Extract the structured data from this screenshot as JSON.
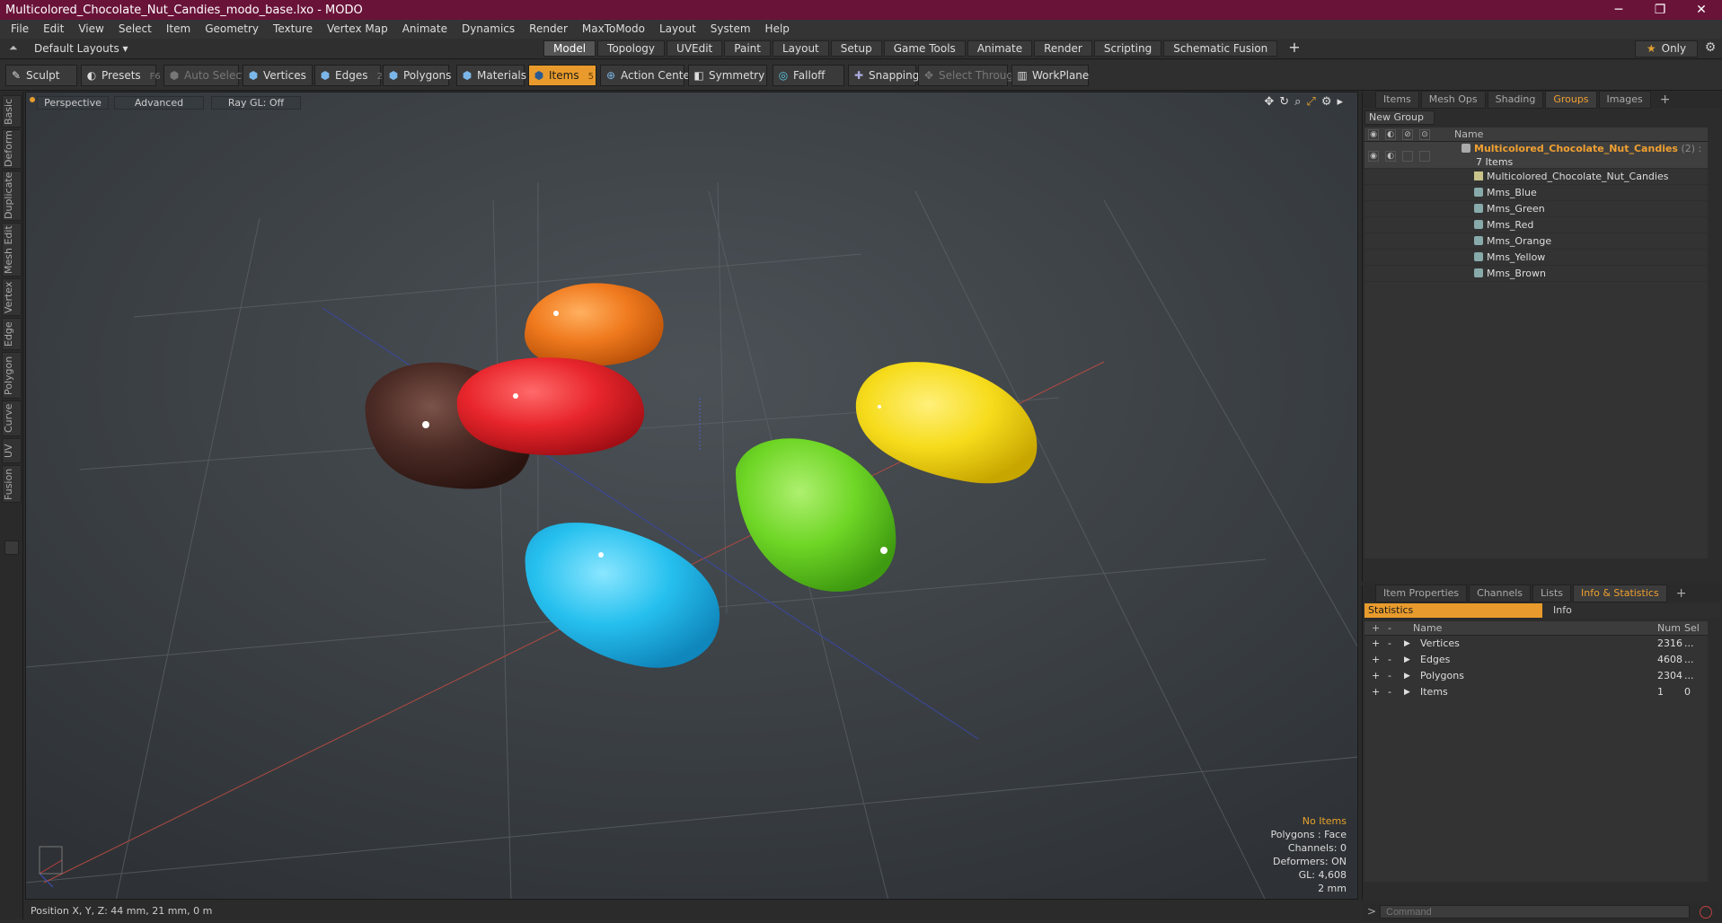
{
  "window": {
    "title": "Multicolored_Chocolate_Nut_Candies_modo_base.lxo - MODO",
    "min": "─",
    "max": "❐",
    "close": "✕"
  },
  "menu": [
    "File",
    "Edit",
    "View",
    "Select",
    "Item",
    "Geometry",
    "Texture",
    "Vertex Map",
    "Animate",
    "Dynamics",
    "Render",
    "MaxToModo",
    "Layout",
    "System",
    "Help"
  ],
  "layout": {
    "default_layouts": "Default Layouts ▾",
    "tabs": [
      "Model",
      "Topology",
      "UVEdit",
      "Paint",
      "Layout",
      "Setup",
      "Game Tools",
      "Animate",
      "Render",
      "Scripting",
      "Schematic Fusion"
    ],
    "active_tab": "Model",
    "plus": "+",
    "only": "Only",
    "only_icon": "★"
  },
  "toolbar": {
    "sculpt": "Sculpt",
    "presets": "Presets",
    "presets_key": "F6",
    "auto_select": "Auto Select",
    "vertices": "Vertices",
    "vertices_key": "1",
    "edges": "Edges",
    "edges_key": "2",
    "polygons": "Polygons",
    "materials": "Materials",
    "items": "Items",
    "items_key": "5",
    "action_center": "Action Center",
    "symmetry": "Symmetry",
    "falloff": "Falloff",
    "snapping": "Snapping",
    "select_through": "Select Through",
    "workplane": "WorkPlane"
  },
  "left_tabs": [
    "Basic",
    "Deform",
    "Duplicate",
    "Mesh Edit",
    "Vertex",
    "Edge",
    "Polygon",
    "Curve",
    "UV",
    "Fusion"
  ],
  "viewport": {
    "perspective": "Perspective",
    "advanced": "Advanced",
    "raygl": "Ray GL: Off",
    "info": {
      "no_items": "No Items",
      "polygons": "Polygons : Face",
      "channels": "Channels: 0",
      "deformers": "Deformers: ON",
      "gl": "GL: 4,608",
      "scale": "2 mm"
    }
  },
  "status": {
    "position": "Position X, Y, Z:  44 mm, 21 mm, 0 m"
  },
  "groups_panel": {
    "tabs": [
      "Items",
      "Mesh Ops",
      "Shading",
      "Groups",
      "Images"
    ],
    "active_tab": "Groups",
    "new_group": "New Group",
    "name_header": "Name",
    "group_name": "Multicolored_Chocolate_Nut_Candies",
    "group_count": "(2) :",
    "items_count": "7 Items",
    "children": [
      "Multicolored_Chocolate_Nut_Candies",
      "Mms_Blue",
      "Mms_Green",
      "Mms_Red",
      "Mms_Orange",
      "Mms_Yellow",
      "Mms_Brown"
    ]
  },
  "stats_panel": {
    "tabs": [
      "Item Properties",
      "Channels",
      "Lists",
      "Info & Statistics"
    ],
    "active_tab": "Info & Statistics",
    "sub_tabs": [
      "Statistics",
      "Info"
    ],
    "headers": {
      "name": "Name",
      "num": "Num",
      "sel": "Sel"
    },
    "rows": [
      {
        "name": "Vertices",
        "num": "2316",
        "sel": "..."
      },
      {
        "name": "Edges",
        "num": "4608",
        "sel": "..."
      },
      {
        "name": "Polygons",
        "num": "2304",
        "sel": "..."
      },
      {
        "name": "Items",
        "num": "1",
        "sel": "0"
      }
    ]
  },
  "command": {
    "placeholder": "Command"
  },
  "candies": [
    {
      "name": "Mms_Orange",
      "color": "#f07a1e"
    },
    {
      "name": "Mms_Brown",
      "color": "#4a2a24"
    },
    {
      "name": "Mms_Red",
      "color": "#e8262c"
    },
    {
      "name": "Mms_Yellow",
      "color": "#f6dc1c"
    },
    {
      "name": "Mms_Blue",
      "color": "#26c0ee"
    },
    {
      "name": "Mms_Green",
      "color": "#6fd626"
    }
  ]
}
